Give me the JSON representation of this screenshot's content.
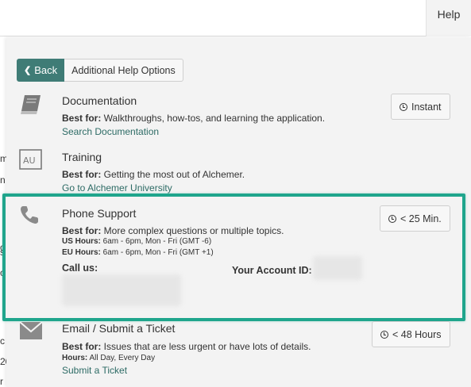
{
  "header": {
    "help_label": "Help"
  },
  "background_fragments": [
    "m",
    "n",
    "o",
    "s",
    "o",
    "c",
    "20",
    "r"
  ],
  "nav": {
    "back_label": "Back",
    "additional_label": "Additional Help Options"
  },
  "options": {
    "documentation": {
      "title": "Documentation",
      "best_for_label": "Best for:",
      "best_for_text": " Walkthroughs, how-tos, and learning the application.",
      "link_label": "Search Documentation",
      "badge": "Instant",
      "icon": "book-icon"
    },
    "training": {
      "title": "Training",
      "best_for_label": "Best for:",
      "best_for_text": " Getting the most out of Alchemer.",
      "link_label": "Go to Alchemer University",
      "icon_text": "AU",
      "icon": "alchemer-university-icon"
    },
    "phone": {
      "title": "Phone Support",
      "best_for_label": "Best for:",
      "best_for_text": " More complex questions or multiple topics.",
      "us_hours_label": "US Hours:",
      "us_hours_text": " 6am - 6pm, Mon - Fri (GMT -6)",
      "eu_hours_label": "EU Hours:",
      "eu_hours_text": " 6am - 6pm, Mon - Fri (GMT +1)",
      "call_us_label": "Call us:",
      "account_id_label": "Your Account ID:",
      "badge": "< 25 Min.",
      "icon": "phone-icon"
    },
    "email": {
      "title": "Email / Submit a Ticket",
      "best_for_label": "Best for:",
      "best_for_text": " Issues that are less urgent or have lots of details.",
      "hours_label": "Hours:",
      "hours_text": " All Day, Every Day",
      "link_label": "Submit a Ticket",
      "badge": "< 48 Hours",
      "icon": "envelope-icon"
    }
  },
  "colors": {
    "accent": "#3f7c76",
    "highlight": "#1fa58c",
    "link": "#2d6b65",
    "panel_bg": "#f3f3f3"
  }
}
